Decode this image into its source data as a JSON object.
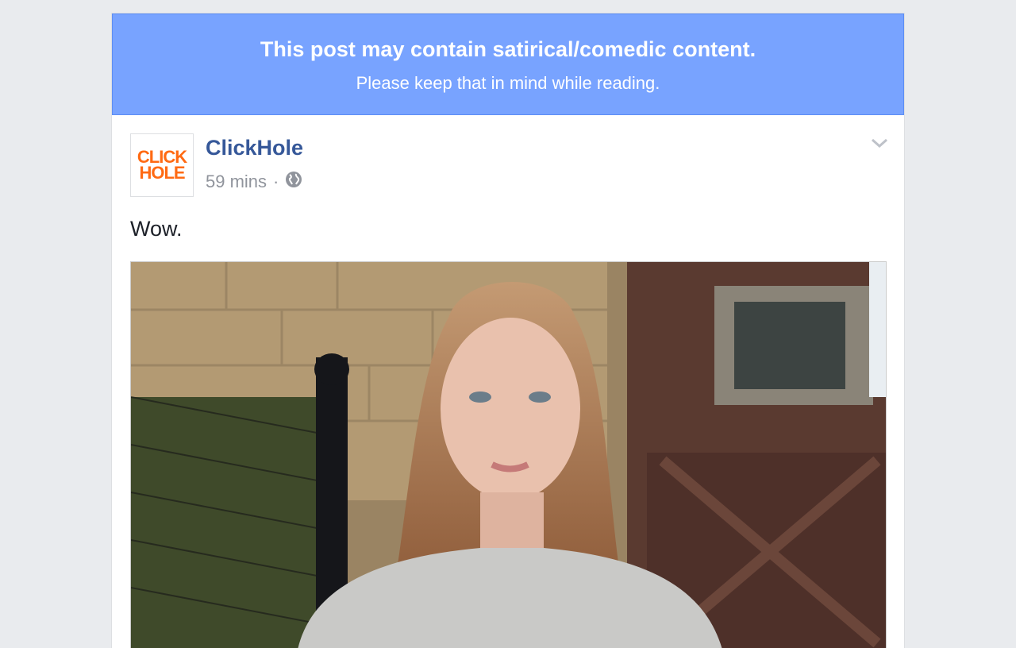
{
  "banner": {
    "title": "This post may contain satirical/comedic content.",
    "subtitle": "Please keep that in mind while reading."
  },
  "post": {
    "page_name": "ClickHole",
    "timestamp": "59 mins",
    "separator": "·",
    "privacy_icon": "globe-icon",
    "menu_icon": "chevron-down-icon",
    "text": "Wow.",
    "logo": {
      "line1": "CLICK",
      "line2": "HOLE"
    }
  },
  "colors": {
    "banner_bg": "#78a3ff",
    "page_name": "#365899",
    "meta": "#90949c",
    "logo": "#ff6a13"
  }
}
